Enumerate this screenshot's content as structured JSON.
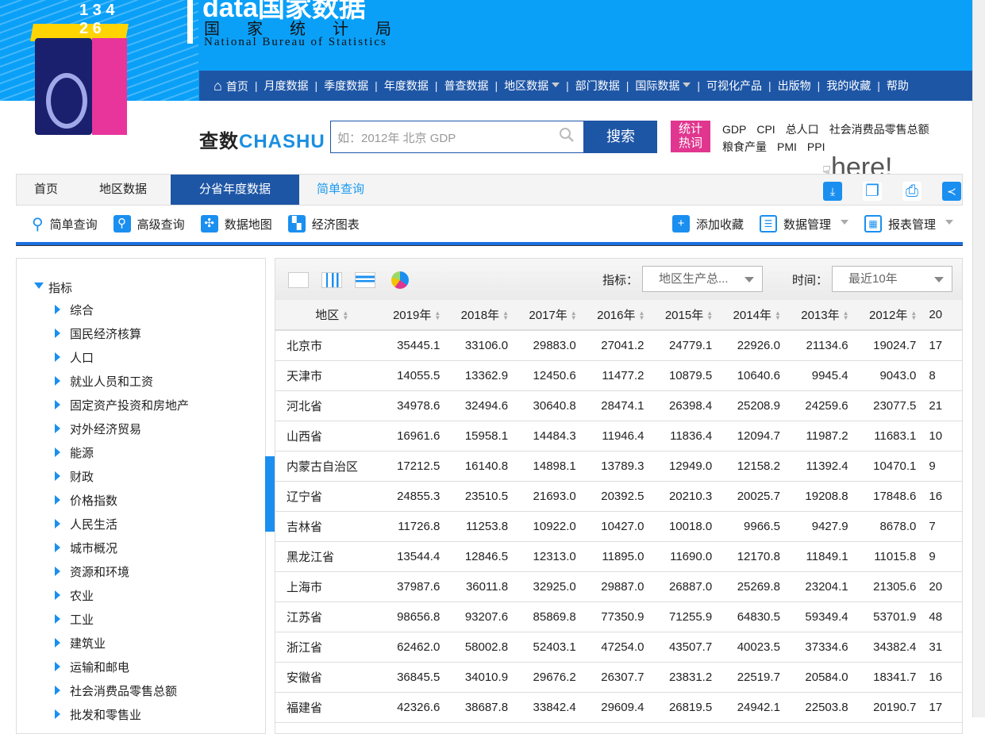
{
  "header": {
    "logo_big": "data国家数据",
    "logo_cn": "国家统计局",
    "logo_en": "National Bureau of Statistics",
    "logo_numbers": "1 3 4 2 6"
  },
  "nav": {
    "items": [
      {
        "label": "首页"
      },
      {
        "label": "月度数据"
      },
      {
        "label": "季度数据"
      },
      {
        "label": "年度数据"
      },
      {
        "label": "普查数据"
      },
      {
        "label": "地区数据",
        "dropdown": true
      },
      {
        "label": "部门数据"
      },
      {
        "label": "国际数据",
        "dropdown": true
      },
      {
        "label": "可视化产品"
      },
      {
        "label": "出版物"
      },
      {
        "label": "我的收藏"
      },
      {
        "label": "帮助"
      }
    ]
  },
  "search": {
    "brand": "查数",
    "brand_en": "CHASHU",
    "placeholder": "如：2012年 北京 GDP",
    "button": "搜索",
    "hot_label_1": "统计",
    "hot_label_2": "热词",
    "hot_words": [
      "GDP",
      "CPI",
      "总人口",
      "社会消费品零售总额",
      "粮食产量",
      "PMI",
      "PPI"
    ]
  },
  "overlay": {
    "here": "here!"
  },
  "breadcrumb": [
    "首页",
    "地区数据",
    "分省年度数据",
    "简单查询"
  ],
  "tools": {
    "left": [
      "简单查询",
      "高级查询",
      "数据地图",
      "经济图表"
    ],
    "right": [
      "添加收藏",
      "数据管理",
      "报表管理"
    ]
  },
  "sidebar": {
    "root": "指标",
    "items": [
      "综合",
      "国民经济核算",
      "人口",
      "就业人员和工资",
      "固定资产投资和房地产",
      "对外经济贸易",
      "能源",
      "财政",
      "价格指数",
      "人民生活",
      "城市概况",
      "资源和环境",
      "农业",
      "工业",
      "建筑业",
      "运输和邮电",
      "社会消费品零售总额",
      "批发和零售业"
    ]
  },
  "panel": {
    "indicator_label": "指标：",
    "indicator_value": "地区生产总...",
    "time_label": "时间：",
    "time_value": "最近10年"
  },
  "table": {
    "headers": [
      "地区",
      "2019年",
      "2018年",
      "2017年",
      "2016年",
      "2015年",
      "2014年",
      "2013年",
      "2012年",
      "20"
    ],
    "rows": [
      [
        "北京市",
        "35445.1",
        "33106.0",
        "29883.0",
        "27041.2",
        "24779.1",
        "22926.0",
        "21134.6",
        "19024.7",
        "17"
      ],
      [
        "天津市",
        "14055.5",
        "13362.9",
        "12450.6",
        "11477.2",
        "10879.5",
        "10640.6",
        "9945.4",
        "9043.0",
        "8"
      ],
      [
        "河北省",
        "34978.6",
        "32494.6",
        "30640.8",
        "28474.1",
        "26398.4",
        "25208.9",
        "24259.6",
        "23077.5",
        "21"
      ],
      [
        "山西省",
        "16961.6",
        "15958.1",
        "14484.3",
        "11946.4",
        "11836.4",
        "12094.7",
        "11987.2",
        "11683.1",
        "10"
      ],
      [
        "内蒙古自治区",
        "17212.5",
        "16140.8",
        "14898.1",
        "13789.3",
        "12949.0",
        "12158.2",
        "11392.4",
        "10470.1",
        "9"
      ],
      [
        "辽宁省",
        "24855.3",
        "23510.5",
        "21693.0",
        "20392.5",
        "20210.3",
        "20025.7",
        "19208.8",
        "17848.6",
        "16"
      ],
      [
        "吉林省",
        "11726.8",
        "11253.8",
        "10922.0",
        "10427.0",
        "10018.0",
        "9966.5",
        "9427.9",
        "8678.0",
        "7"
      ],
      [
        "黑龙江省",
        "13544.4",
        "12846.5",
        "12313.0",
        "11895.0",
        "11690.0",
        "12170.8",
        "11849.1",
        "11015.8",
        "9"
      ],
      [
        "上海市",
        "37987.6",
        "36011.8",
        "32925.0",
        "29887.0",
        "26887.0",
        "25269.8",
        "23204.1",
        "21305.6",
        "20"
      ],
      [
        "江苏省",
        "98656.8",
        "93207.6",
        "85869.8",
        "77350.9",
        "71255.9",
        "64830.5",
        "59349.4",
        "53701.9",
        "48"
      ],
      [
        "浙江省",
        "62462.0",
        "58002.8",
        "52403.1",
        "47254.0",
        "43507.7",
        "40023.5",
        "37334.6",
        "34382.4",
        "31"
      ],
      [
        "安徽省",
        "36845.5",
        "34010.9",
        "29676.2",
        "26307.7",
        "23831.2",
        "22519.7",
        "20584.0",
        "18341.7",
        "16"
      ],
      [
        "福建省",
        "42326.6",
        "38687.8",
        "33842.4",
        "29609.4",
        "26819.5",
        "24942.1",
        "22503.8",
        "20190.7",
        "17"
      ]
    ]
  },
  "colors": {
    "header_blue": "#0aa0f8",
    "nav_blue": "#1e56a6",
    "accent": "#1a8ff0",
    "hot_pink": "#e0368f"
  }
}
